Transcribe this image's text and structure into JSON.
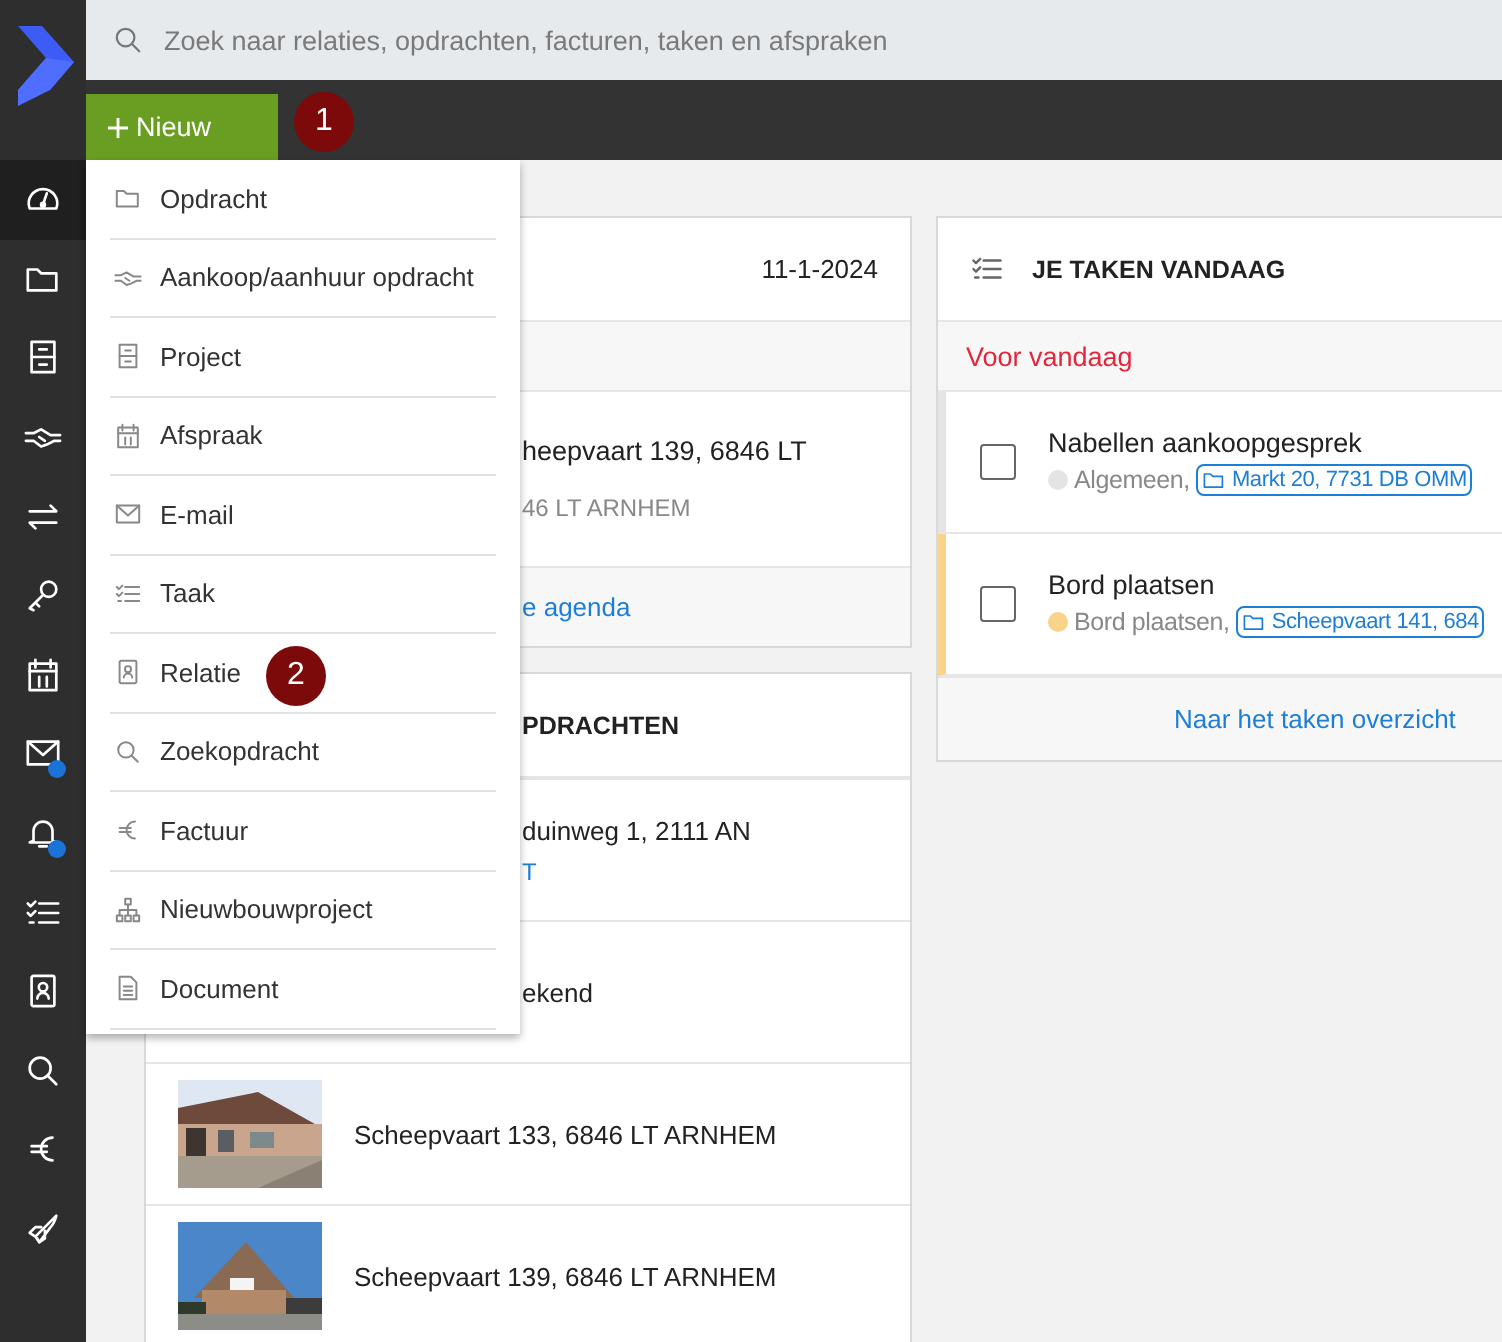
{
  "search": {
    "placeholder": "Zoek naar relaties, opdrachten, facturen, taken en afspraken"
  },
  "new_button": {
    "label": "Nieuw",
    "badge": "1"
  },
  "sidebar": {
    "items": [
      {
        "kind": "dashboard",
        "selected": true,
        "notification": false
      },
      {
        "kind": "folder",
        "selected": false,
        "notification": false
      },
      {
        "kind": "cabinet",
        "selected": false,
        "notification": false
      },
      {
        "kind": "handshake",
        "selected": false,
        "notification": false
      },
      {
        "kind": "exchange",
        "selected": false,
        "notification": false
      },
      {
        "kind": "key",
        "selected": false,
        "notification": false
      },
      {
        "kind": "calendar",
        "selected": false,
        "notification": false
      },
      {
        "kind": "mail",
        "selected": false,
        "notification": true
      },
      {
        "kind": "bell",
        "selected": false,
        "notification": true
      },
      {
        "kind": "tasks",
        "selected": false,
        "notification": false
      },
      {
        "kind": "contact",
        "selected": false,
        "notification": false
      },
      {
        "kind": "search",
        "selected": false,
        "notification": false
      },
      {
        "kind": "euro",
        "selected": false,
        "notification": false
      },
      {
        "kind": "rocket",
        "selected": false,
        "notification": false
      }
    ]
  },
  "new_menu": {
    "items": [
      {
        "kind": "folder",
        "label": "Opdracht"
      },
      {
        "kind": "handshake",
        "label": "Aankoop/aanhuur opdracht"
      },
      {
        "kind": "cabinet",
        "label": "Project"
      },
      {
        "kind": "calendar",
        "label": "Afspraak"
      },
      {
        "kind": "mail",
        "label": "E-mail"
      },
      {
        "kind": "tasks",
        "label": "Taak"
      },
      {
        "kind": "contact",
        "label": "Relatie",
        "badge": "2"
      },
      {
        "kind": "search",
        "label": "Zoekopdracht"
      },
      {
        "kind": "euro",
        "label": "Factuur"
      },
      {
        "kind": "hierarchy",
        "label": "Nieuwbouwproject"
      },
      {
        "kind": "document",
        "label": "Document"
      }
    ]
  },
  "agenda_card": {
    "date": "11-1-2024",
    "event_title": "heepvaart 139, 6846 LT",
    "event_subtitle": "46 LT ARNHEM",
    "footer_link": "e agenda"
  },
  "assignments_card": {
    "title": "PDRACHTEN",
    "rows": [
      {
        "text": "duinweg 1, 2111 AN",
        "extra": "T",
        "photo": false
      },
      {
        "text": "ekend",
        "photo": false
      },
      {
        "text": "Scheepvaart 133, 6846 LT ARNHEM",
        "photo": true
      },
      {
        "text": "Scheepvaart 139, 6846 LT ARNHEM",
        "photo": true
      }
    ]
  },
  "tasks_card": {
    "title": "JE TAKEN VANDAAG",
    "section": "Voor vandaag",
    "tasks": [
      {
        "title": "Nabellen aankoopgesprek",
        "category": "Algemeen,",
        "color": "#e4e4e4",
        "link": "Markt 20, 7731 DB OMM",
        "checked": false
      },
      {
        "title": "Bord plaatsen",
        "category": "Bord plaatsen,",
        "color": "#f9d38a",
        "link": "Scheepvaart 141, 684",
        "checked": false
      }
    ],
    "footer_link": "Naar het taken overzicht"
  }
}
